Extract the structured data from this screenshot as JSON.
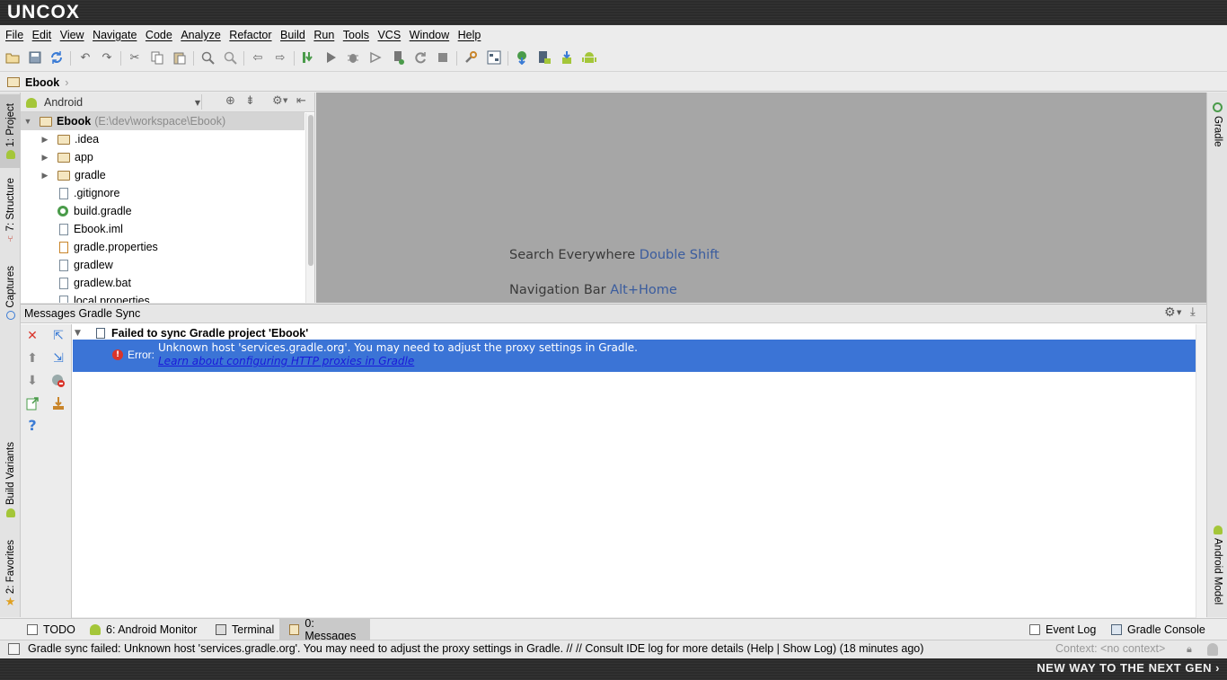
{
  "app": {
    "logo": "UNCOX"
  },
  "menu": [
    "File",
    "Edit",
    "View",
    "Navigate",
    "Code",
    "Analyze",
    "Refactor",
    "Build",
    "Run",
    "Tools",
    "VCS",
    "Window",
    "Help"
  ],
  "breadcrumb": {
    "project": "Ebook"
  },
  "left_stripe": {
    "project": "1: Project",
    "structure": "7: Structure",
    "captures": "Captures",
    "build_variants": "Build Variants",
    "favorites": "2: Favorites"
  },
  "right_stripe": {
    "gradle": "Gradle",
    "android_model": "Android Model"
  },
  "project_panel": {
    "view_selector": "Android",
    "root": {
      "name": "Ebook",
      "path": "(E:\\dev\\workspace\\Ebook)"
    },
    "items": [
      ".idea",
      "app",
      "gradle",
      ".gitignore",
      "build.gradle",
      "Ebook.iml",
      "gradle.properties",
      "gradlew",
      "gradlew.bat",
      "local.properties"
    ]
  },
  "editor": {
    "hint1_text": "Search Everywhere",
    "hint1_key": "Double Shift",
    "hint2_text": "Navigation Bar",
    "hint2_key": "Alt+Home"
  },
  "messages": {
    "title": "Messages Gradle Sync",
    "sync_title": "Failed to sync Gradle project 'Ebook'",
    "error_label": "Error:",
    "error_text": "Unknown host 'services.gradle.org'. You may need to adjust the proxy settings in Gradle.",
    "error_link": "Learn about configuring HTTP proxies in Gradle"
  },
  "bottom_tabs": {
    "todo": "TODO",
    "android_monitor": "6: Android Monitor",
    "terminal": "Terminal",
    "messages": "0: Messages",
    "event_log": "Event Log",
    "gradle_console": "Gradle Console"
  },
  "status": {
    "text": "Gradle sync failed: Unknown host 'services.gradle.org'. You may need to adjust the proxy settings in Gradle. // // Consult IDE log for more details (Help | Show Log) (18 minutes ago)",
    "context": "Context: <no context>"
  },
  "footer": {
    "tagline": "NEW WAY TO THE NEXT GEN"
  },
  "colors": {
    "selection": "#3b74d6",
    "editor_bg": "#a6a6a6",
    "android_green": "#a4c639",
    "error_red": "#d9352b",
    "link_blue": "#1a1ad9"
  }
}
